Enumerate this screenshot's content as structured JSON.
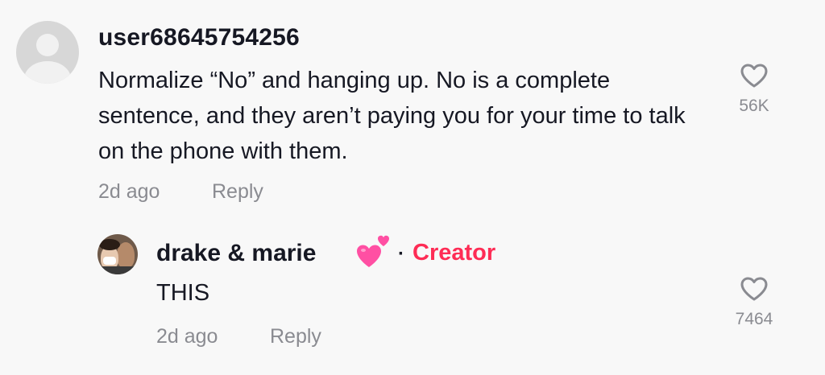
{
  "comment": {
    "username": "user68645754256",
    "text": "Normalize “No” and hanging up. No is a complete sentence, and they aren’t paying you for your time to talk on the phone with them.",
    "time": "2d ago",
    "reply_label": "Reply",
    "like_count": "56K",
    "avatar_icon": "default-avatar-icon",
    "like_icon": "heart-outline-icon"
  },
  "reply": {
    "username": "drake & marie",
    "badge_separator": "·",
    "badge": "Creator",
    "text": "THIS",
    "time": "2d ago",
    "reply_label": "Reply",
    "like_count": "7464",
    "emoji_icon": "two-hearts-icon",
    "like_icon": "heart-outline-icon"
  },
  "colors": {
    "background": "#f8f8f8",
    "primary_text": "#161823",
    "secondary_text": "#8a8b91",
    "creator_accent": "#fe2c55",
    "emoji_pink": "#ff4fa3"
  }
}
